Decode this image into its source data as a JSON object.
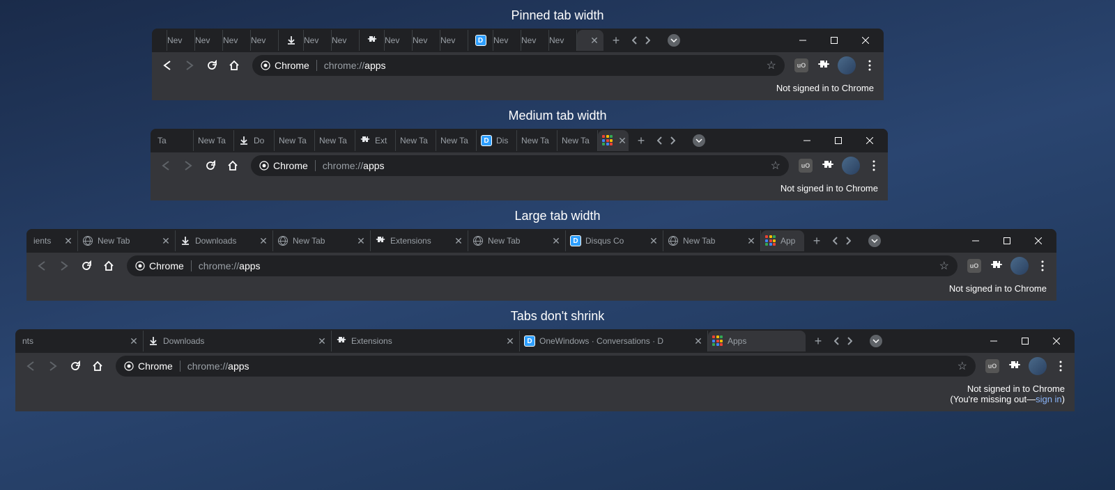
{
  "labels": {
    "pinned": "Pinned tab width",
    "medium": "Medium tab width",
    "large": "Large tab width",
    "noshrink": "Tabs don't shrink"
  },
  "common": {
    "chrome_label": "Chrome",
    "url_prefix": "chrome://",
    "url_path": "apps",
    "not_signed": "Not signed in to Chrome",
    "missing_out": "(You're missing out—",
    "sign_in": "sign in",
    "close_paren": ")",
    "ublock": "uO"
  },
  "pinned": {
    "tabs": [
      {
        "type": "partial",
        "text": ""
      },
      {
        "type": "text",
        "text": "Nev"
      },
      {
        "type": "text",
        "text": "Nev"
      },
      {
        "type": "text",
        "text": "Nev"
      },
      {
        "type": "text",
        "text": "Nev"
      },
      {
        "type": "download",
        "text": ""
      },
      {
        "type": "text",
        "text": "Nev"
      },
      {
        "type": "text",
        "text": "Nev"
      },
      {
        "type": "puzzle",
        "text": ""
      },
      {
        "type": "text",
        "text": "Nev"
      },
      {
        "type": "text",
        "text": "Nev"
      },
      {
        "type": "text",
        "text": "Nev"
      },
      {
        "type": "disqus",
        "text": ""
      },
      {
        "type": "text",
        "text": "Nev"
      },
      {
        "type": "text",
        "text": "Nev"
      },
      {
        "type": "text",
        "text": "Nev"
      }
    ],
    "active": {
      "type": "active",
      "close": true
    }
  },
  "medium": {
    "tabs": [
      {
        "type": "text",
        "text": "Ta"
      },
      {
        "type": "text",
        "text": "New Ta"
      },
      {
        "type": "download",
        "text": "Do"
      },
      {
        "type": "text",
        "text": "New Ta"
      },
      {
        "type": "text",
        "text": "New Ta"
      },
      {
        "type": "puzzle",
        "text": "Ext"
      },
      {
        "type": "text",
        "text": "New Ta"
      },
      {
        "type": "text",
        "text": "New Ta"
      },
      {
        "type": "disqus",
        "text": "Dis"
      },
      {
        "type": "text",
        "text": "New Ta"
      },
      {
        "type": "text",
        "text": "New Ta"
      }
    ],
    "active": {
      "type": "app",
      "close": true
    }
  },
  "large": {
    "tabs": [
      {
        "type": "partial",
        "text": "ients",
        "close": true
      },
      {
        "type": "globe",
        "text": "New Tab",
        "close": true
      },
      {
        "type": "download",
        "text": "Downloads",
        "close": true
      },
      {
        "type": "globe",
        "text": "New Tab",
        "close": true
      },
      {
        "type": "puzzle",
        "text": "Extensions",
        "close": true
      },
      {
        "type": "globe",
        "text": "New Tab",
        "close": true
      },
      {
        "type": "disqus",
        "text": "Disqus Co",
        "close": true
      },
      {
        "type": "globe",
        "text": "New Tab",
        "close": true
      }
    ],
    "active": {
      "type": "app",
      "text": "App",
      "close": false
    }
  },
  "noshrink": {
    "tabs": [
      {
        "type": "partial",
        "text": "nts",
        "close": true
      },
      {
        "type": "download",
        "text": "Downloads",
        "close": true
      },
      {
        "type": "puzzle",
        "text": "Extensions",
        "close": true
      },
      {
        "type": "disqus",
        "text": "OneWindows · Conversations · D",
        "close": true
      }
    ],
    "active": {
      "type": "app",
      "text": "Apps",
      "close": false
    }
  }
}
